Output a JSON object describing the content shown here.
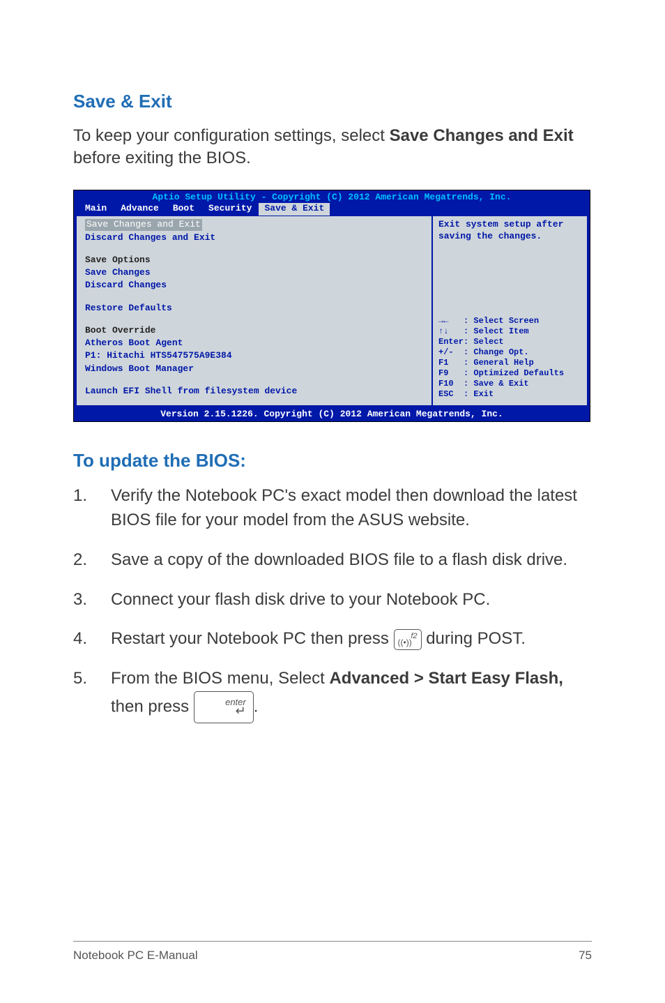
{
  "section1": {
    "heading": "Save & Exit",
    "intro_pre": "To keep your configuration settings, select ",
    "intro_bold": "Save Changes and Exit",
    "intro_post": " before exiting the BIOS."
  },
  "bios": {
    "title": "Aptio Setup Utility - Copyright (C) 2012 American Megatrends, Inc.",
    "tabs": [
      "Main",
      "Advance",
      "Boot",
      "Security",
      "Save & Exit"
    ],
    "active_tab_index": 4,
    "left": {
      "selected": "Save Changes and Exit",
      "items1": [
        "Discard Changes and Exit"
      ],
      "group1_head": "Save Options",
      "group1_items": [
        "Save Changes",
        "Discard Changes"
      ],
      "restore": "Restore Defaults",
      "group2_head": "Boot Override",
      "group2_items": [
        "Atheros Boot Agent",
        "P1: Hitachi HTS547575A9E384",
        "Windows Boot Manager"
      ],
      "launch": "Launch EFI Shell from filesystem device"
    },
    "right": {
      "help1": "Exit system setup after",
      "help2": "saving the changes.",
      "keys": "→←   : Select Screen\n↑↓   : Select Item\nEnter: Select\n+/-  : Change Opt.\nF1   : General Help\nF9   : Optimized Defaults\nF10  : Save & Exit\nESC  : Exit"
    },
    "footer": "Version 2.15.1226. Copyright (C) 2012 American Megatrends, Inc."
  },
  "section2": {
    "heading": "To update the BIOS:"
  },
  "steps": {
    "s1": "Verify the Notebook PC's exact model then download the latest BIOS file for your model from the ASUS website.",
    "s2": "Save a copy of the downloaded BIOS file to a flash disk drive.",
    "s3": "Connect your flash disk drive to your Notebook PC.",
    "s4_pre": "Restart your Notebook PC then press ",
    "s4_post": " during POST.",
    "s5_pre": "From the BIOS menu, Select ",
    "s5_bold": "Advanced > Start Easy Flash,",
    "s5_mid": " then press ",
    "s5_post": "."
  },
  "keycap_f2": {
    "top": "f2",
    "glyph": "((•))"
  },
  "keycap_enter": {
    "label": "enter",
    "arrow": "↵"
  },
  "footer": {
    "left": "Notebook PC E-Manual",
    "right": "75"
  }
}
